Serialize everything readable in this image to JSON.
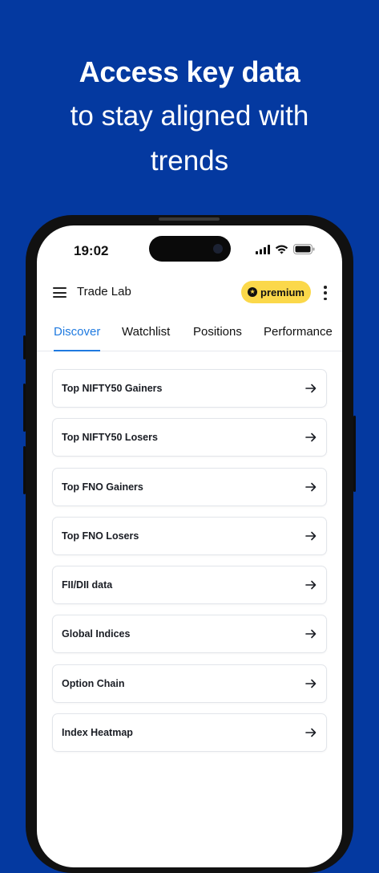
{
  "hero": {
    "title_bold": "Access key data",
    "subtitle_line1": "to stay aligned with",
    "subtitle_line2": "trends"
  },
  "status_bar": {
    "time": "19:02"
  },
  "header": {
    "menu_icon": "hamburger-menu-icon",
    "title": "Trade Lab",
    "premium_label": "premium",
    "premium_icon": "star-icon",
    "more_icon": "more-vertical-icon"
  },
  "tabs": [
    {
      "label": "Discover",
      "active": true
    },
    {
      "label": "Watchlist",
      "active": false
    },
    {
      "label": "Positions",
      "active": false
    },
    {
      "label": "Performance",
      "active": false
    }
  ],
  "list": {
    "items": [
      {
        "label": "Top NIFTY50 Gainers",
        "icon": "arrow-right-icon"
      },
      {
        "label": "Top NIFTY50 Losers",
        "icon": "arrow-right-icon"
      },
      {
        "label": "Top FNO Gainers",
        "icon": "arrow-right-icon"
      },
      {
        "label": "Top FNO Losers",
        "icon": "arrow-right-icon"
      },
      {
        "label": "FII/DII data",
        "icon": "arrow-right-icon"
      },
      {
        "label": "Global Indices",
        "icon": "arrow-right-icon"
      },
      {
        "label": "Option Chain",
        "icon": "arrow-right-icon"
      },
      {
        "label": "Index Heatmap",
        "icon": "arrow-right-icon"
      }
    ]
  },
  "colors": {
    "background": "#0439a0",
    "accent": "#1f7ae0",
    "premium": "#fbd84a"
  }
}
